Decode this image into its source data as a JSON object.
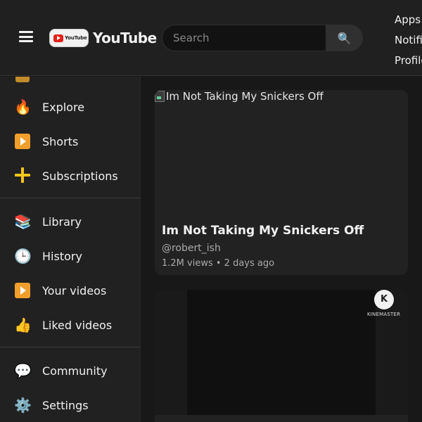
{
  "header": {
    "logo_badge_text": "YouTube",
    "logo_text": "YouTube",
    "search_placeholder": "Search",
    "links": [
      "Apps",
      "Notifications",
      "Profile"
    ]
  },
  "sidebar": {
    "items": [
      {
        "label": "Explore",
        "icon": "fire-icon"
      },
      {
        "label": "Shorts",
        "icon": "play-square-icon"
      },
      {
        "label": "Subscriptions",
        "icon": "plus-icon"
      },
      {
        "label": "Library",
        "icon": "books-icon"
      },
      {
        "label": "History",
        "icon": "clock-icon"
      },
      {
        "label": "Your videos",
        "icon": "play-square-icon"
      },
      {
        "label": "Liked videos",
        "icon": "thumbs-up-icon"
      },
      {
        "label": "Community",
        "icon": "speech-bubble-icon"
      },
      {
        "label": "Settings",
        "icon": "gear-icon"
      }
    ]
  },
  "videos": [
    {
      "thumbnail_alt": "Im Not Taking My Snickers Off",
      "title": "Im Not Taking My Snickers Off",
      "channel": "@robert_ish",
      "views": "1.2M views",
      "age": "2 days ago",
      "meta": "1.2M views • 2 days ago"
    },
    {
      "watermark": "K",
      "watermark_label": "KINEMASTER"
    }
  ],
  "colors": {
    "background": "#181818",
    "surface": "#212121",
    "card": "#222222",
    "text": "#f1f1f1",
    "muted": "#aaaaaa"
  }
}
